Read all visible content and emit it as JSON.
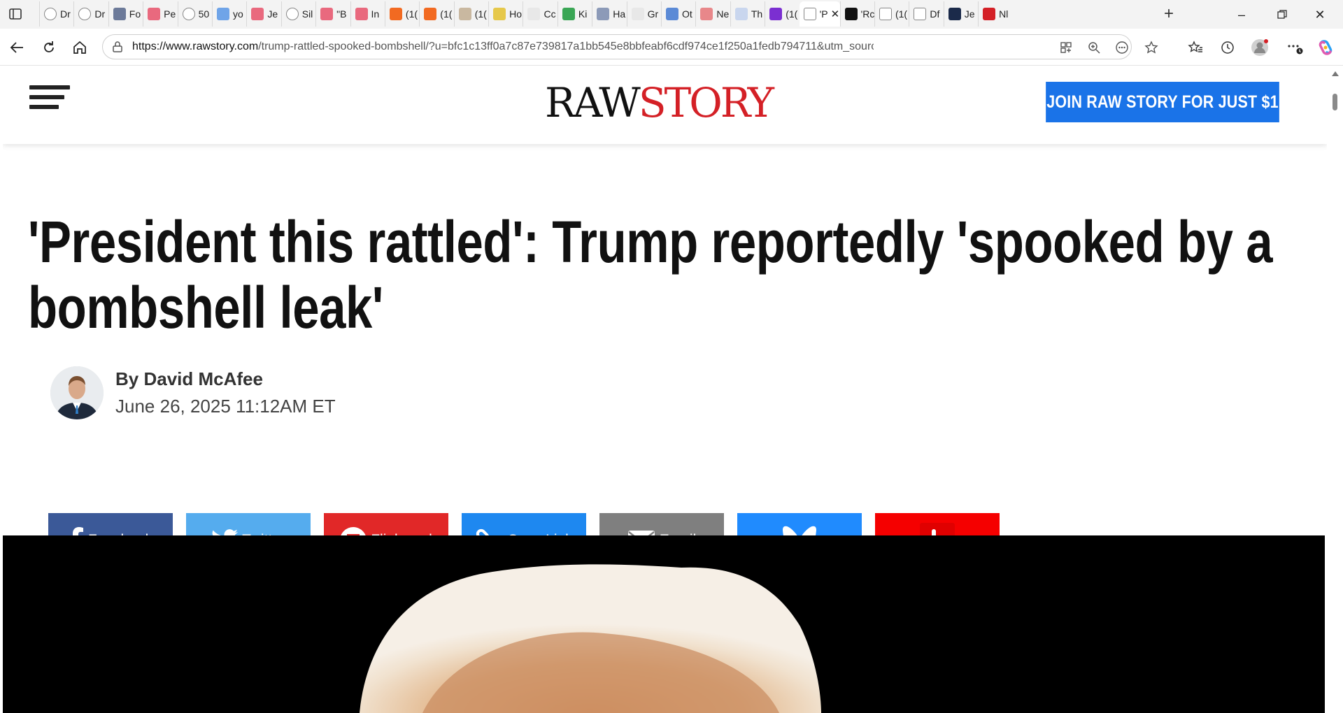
{
  "browser": {
    "tabs": [
      {
        "label": "Dr",
        "fav_color": "#ffffff",
        "fav_icon": "globe-icon"
      },
      {
        "label": "Dr",
        "fav_color": "#ffffff",
        "fav_icon": "globe-icon"
      },
      {
        "label": "Fo",
        "fav_color": "#6c7a99",
        "fav_icon": "news-icon"
      },
      {
        "label": "Pe",
        "fav_color": "#e9697e",
        "fav_icon": "youtube-icon"
      },
      {
        "label": "50",
        "fav_color": "#ffffff",
        "fav_icon": "globe-icon"
      },
      {
        "label": "yo",
        "fav_color": "#6fa4e8",
        "fav_icon": "bing-icon"
      },
      {
        "label": "Je",
        "fav_color": "#e9697e",
        "fav_icon": "youtube-icon"
      },
      {
        "label": "Sil",
        "fav_color": "#ffffff",
        "fav_icon": "globe-icon"
      },
      {
        "label": "\"B",
        "fav_color": "#e9697e",
        "fav_icon": "youtube-icon"
      },
      {
        "label": "In",
        "fav_color": "#e9697e",
        "fav_icon": "youtube-icon"
      },
      {
        "label": "(1(",
        "fav_color": "#f26a21",
        "fav_icon": "substack-icon"
      },
      {
        "label": "(1(",
        "fav_color": "#f26a21",
        "fav_icon": "substack-icon"
      },
      {
        "label": "(1(",
        "fav_color": "#c9b8a0",
        "fav_icon": "page-icon"
      },
      {
        "label": "Ho",
        "fav_color": "#e6c84a",
        "fav_icon": "page-icon"
      },
      {
        "label": "Cc",
        "fav_color": "#e8e8e8",
        "fav_icon": "arrow-icon"
      },
      {
        "label": "Ki",
        "fav_color": "#3aa655",
        "fav_icon": "page-icon"
      },
      {
        "label": "Ha",
        "fav_color": "#8c9ab8",
        "fav_icon": "shield-icon"
      },
      {
        "label": "Gr",
        "fav_color": "#e8e8e8",
        "fav_icon": "google-icon"
      },
      {
        "label": "Ot",
        "fav_color": "#5b8ad6",
        "fav_icon": "m-icon"
      },
      {
        "label": "Ne",
        "fav_color": "#e8878a",
        "fav_icon": "r-icon"
      },
      {
        "label": "Th",
        "fav_color": "#c9d6ee",
        "fav_icon": "gp-icon"
      },
      {
        "label": "(1(",
        "fav_color": "#7b2fd1",
        "fav_icon": "mail-icon"
      },
      {
        "label": "'P",
        "fav_color": "#ffffff",
        "fav_icon": "page-icon",
        "active": true
      },
      {
        "label": "'Rc",
        "fav_color": "#111111",
        "fav_icon": "r-icon"
      },
      {
        "label": "(1(",
        "fav_color": "#ffffff",
        "fav_icon": "fp-icon"
      },
      {
        "label": "Df",
        "fav_color": "#ffffff",
        "fav_icon": "df-icon"
      },
      {
        "label": "Je",
        "fav_color": "#1b2a4a",
        "fav_icon": "jet-icon"
      },
      {
        "label": "Nl",
        "fav_color": "#d42026",
        "fav_icon": "pdf-icon"
      }
    ],
    "url_host": "https://www.rawstory.com",
    "url_path": "/trump-rattled-spooked-bombshell/?u=bfc1c13ff0a7c87e739817a1bb545e8bbfeabf6cdf974ce1f250a1fedb794711&utm_source=Iterable&utm..."
  },
  "site": {
    "logo_raw": "RAW",
    "logo_story": "STORY",
    "join_label": "JOIN RAW STORY FOR JUST $1"
  },
  "article": {
    "headline": "'President this rattled': Trump reportedly 'spooked by a bombshell leak'",
    "author": "By David McAfee",
    "date": "June 26, 2025 11:12AM ET"
  },
  "share": [
    {
      "label": "Facebook",
      "color": "#3b5998",
      "icon": "facebook-icon"
    },
    {
      "label": "Twitter",
      "color": "#55acee",
      "icon": "twitter-icon"
    },
    {
      "label": "Flipboard",
      "color": "#e12828",
      "icon": "flipboard-icon"
    },
    {
      "label": "Copy Link",
      "color": "#1e88f0",
      "icon": "link-icon"
    },
    {
      "label": "Email",
      "color": "#7f7f7f",
      "icon": "email-icon"
    },
    {
      "label": "",
      "color": "#208bfe",
      "icon": "bluesky-icon"
    },
    {
      "label": "",
      "color": "#f50000",
      "icon": "beehiiv-icon"
    }
  ]
}
